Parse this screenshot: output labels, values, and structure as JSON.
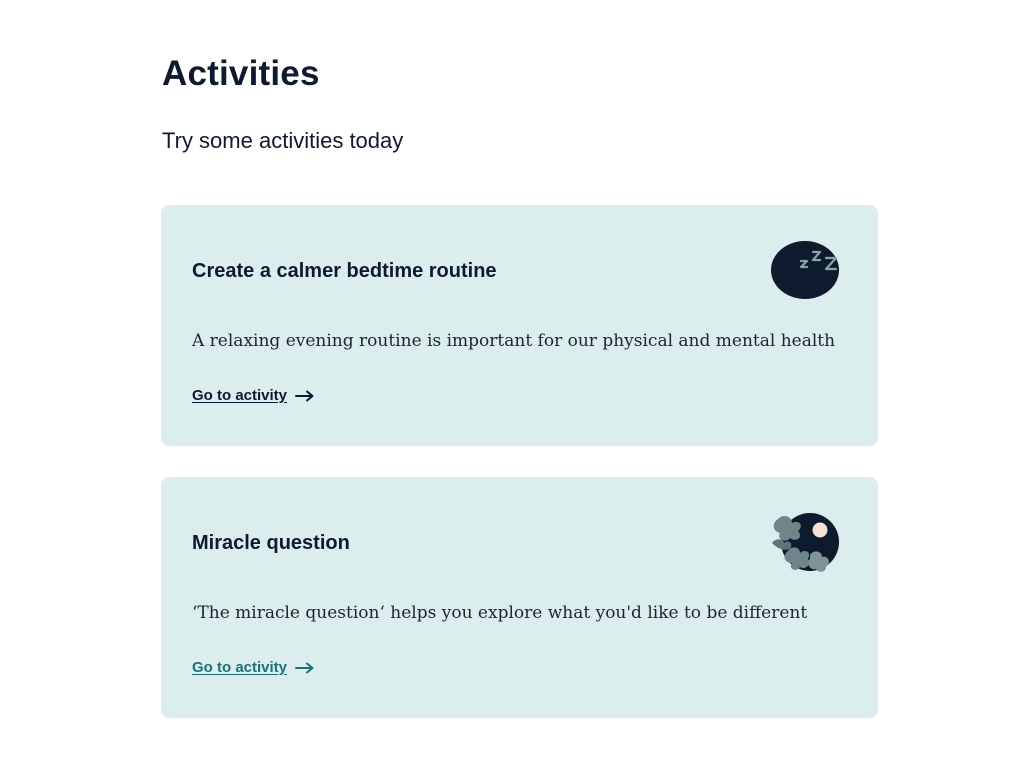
{
  "header": {
    "title": "Activities",
    "subtitle": "Try some activities today"
  },
  "cards": [
    {
      "heading": "Create a calmer bedtime routine",
      "description": "A relaxing evening routine is important for our physical and mental health",
      "link_label": "Go to activity",
      "illustration_icon": "sleep-zzz-icon",
      "link_color": "#0e1a2d"
    },
    {
      "heading": "Miracle question",
      "description": "‘The miracle question‘ helps you explore what you'd like to be different",
      "link_label": "Go to activity",
      "illustration_icon": "night-leaves-icon",
      "link_color": "#1d6f7a"
    }
  ],
  "colors": {
    "card_background": "#dcedee",
    "text_dark": "#0e1a2d",
    "link_visited": "#1d6f7a"
  }
}
